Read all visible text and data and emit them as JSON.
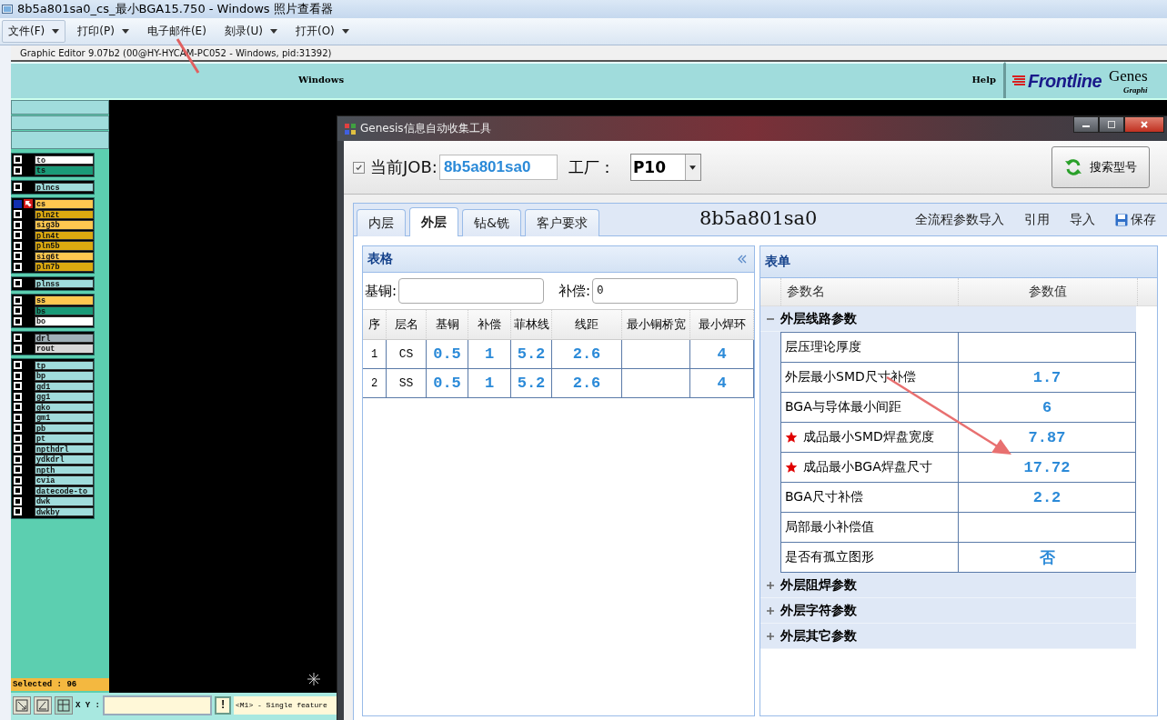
{
  "viewer": {
    "title": "8b5a801sa0_cs_最小BGA15.750 - Windows 照片查看器",
    "menu": [
      {
        "label": "文件(F)",
        "dropdown": true,
        "selected": true
      },
      {
        "label": "打印(P)",
        "dropdown": true,
        "selected": false
      },
      {
        "label": "电子邮件(E)",
        "dropdown": false,
        "selected": false
      },
      {
        "label": "刻录(U)",
        "dropdown": true,
        "selected": false
      },
      {
        "label": "打开(O)",
        "dropdown": true,
        "selected": false
      }
    ]
  },
  "editor": {
    "title": "Graphic Editor 9.07b2 (00@HY-HYCAM-PC052 - Windows, pid:31392)",
    "menus": [
      "Windows",
      "Help"
    ],
    "brand": "Frontline",
    "product": "Genes",
    "product_subtitle": "Graphi",
    "layer_groups": [
      [
        {
          "name": "to",
          "color": "#ffffff",
          "selected": false
        },
        {
          "name": "ts",
          "color": "#1a9a78",
          "selected": false
        }
      ],
      [
        {
          "name": "plncs",
          "color": "#a0dcdc",
          "selected": false
        }
      ],
      [
        {
          "name": "cs",
          "color": "#ffc850",
          "selected": true
        },
        {
          "name": "pln2t",
          "color": "#dcaa10",
          "selected": false
        },
        {
          "name": "sig3b",
          "color": "#ffc850",
          "selected": false
        },
        {
          "name": "pln4t",
          "color": "#dcaa10",
          "selected": false
        },
        {
          "name": "pln5b",
          "color": "#dcaa10",
          "selected": false
        },
        {
          "name": "sig6t",
          "color": "#ffc850",
          "selected": false
        },
        {
          "name": "pln7b",
          "color": "#dcaa10",
          "selected": false
        }
      ],
      [
        {
          "name": "plnss",
          "color": "#a0dcdc",
          "selected": false
        }
      ],
      [
        {
          "name": "ss",
          "color": "#ffc850",
          "selected": false
        },
        {
          "name": "bs",
          "color": "#1a9a78",
          "selected": false
        },
        {
          "name": "bo",
          "color": "#ffffff",
          "selected": false
        }
      ],
      [
        {
          "name": "drl",
          "color": "#a0b0b8",
          "selected": false
        },
        {
          "name": "rout",
          "color": "#d8d8d8",
          "selected": false
        }
      ],
      [
        {
          "name": "tp",
          "color": "#a0dcdc",
          "selected": false
        },
        {
          "name": "bp",
          "color": "#a0dcdc",
          "selected": false
        },
        {
          "name": "gd1",
          "color": "#a0dcdc",
          "selected": false
        },
        {
          "name": "gg1",
          "color": "#a0dcdc",
          "selected": false
        },
        {
          "name": "gko",
          "color": "#a0dcdc",
          "selected": false
        },
        {
          "name": "gm1",
          "color": "#a0dcdc",
          "selected": false
        },
        {
          "name": "pb",
          "color": "#a0dcdc",
          "selected": false
        },
        {
          "name": "pt",
          "color": "#a0dcdc",
          "selected": false
        },
        {
          "name": "npthdrl",
          "color": "#a0dcdc",
          "selected": false
        },
        {
          "name": "ydkdrl",
          "color": "#a0dcdc",
          "selected": false
        },
        {
          "name": "npth",
          "color": "#a0dcdc",
          "selected": false
        },
        {
          "name": "cvia",
          "color": "#a0dcdc",
          "selected": false
        },
        {
          "name": "datecode-to",
          "color": "#a0dcdc",
          "selected": false
        },
        {
          "name": "dwk",
          "color": "#a0dcdc",
          "selected": false
        },
        {
          "name": "dwkby",
          "color": "#a0dcdc",
          "selected": false
        }
      ]
    ],
    "selected_count": "Selected : 96",
    "xy_label": "X Y :",
    "alert_button": "!",
    "status": "<M1> - Single feature"
  },
  "dialog": {
    "title": "Genesis信息自动收集工具",
    "job": {
      "checked": true,
      "label": "当前JOB:",
      "value": "8b5a801sa0"
    },
    "factory": {
      "label": "工厂：",
      "value": "P10"
    },
    "search_button": "搜索型号",
    "tabs": [
      {
        "label": "内层",
        "selected": false
      },
      {
        "label": "外层",
        "selected": true
      },
      {
        "label": "钻&铣",
        "selected": false
      },
      {
        "label": "客户要求",
        "selected": false
      }
    ],
    "job_title": "8b5a801sa0",
    "actions": [
      {
        "label": "全流程参数导入",
        "kind": "link"
      },
      {
        "label": "引用",
        "kind": "link"
      },
      {
        "label": "导入",
        "kind": "link"
      },
      {
        "label": "保存",
        "kind": "save"
      }
    ],
    "table_panel": {
      "title": "表格",
      "fields": [
        {
          "label": "基铜:"
        },
        {
          "label": "补偿:",
          "value": "0"
        }
      ],
      "columns": [
        "序",
        "层名",
        "基铜",
        "补偿",
        "菲林线",
        "线距",
        "最小铜桥宽",
        "最小焊环"
      ],
      "rows": [
        [
          "1",
          "CS",
          "0.5",
          "1",
          "5.2",
          "2.6",
          null,
          "4"
        ],
        [
          "2",
          "SS",
          "0.5",
          "1",
          "5.2",
          "2.6",
          null,
          "4"
        ]
      ]
    },
    "form_panel": {
      "title": "表单",
      "columns": [
        "参数名",
        "参数值"
      ],
      "groups": [
        {
          "label": "外层线路参数",
          "expanded": true,
          "rows": [
            {
              "name": "层压理论厚度",
              "required": false
            },
            {
              "name": "外层最小SMD尺寸补偿",
              "value": "1.7",
              "required": false
            },
            {
              "name": "BGA与导体最小间距",
              "value": "6",
              "required": false
            },
            {
              "name": "成品最小SMD焊盘宽度",
              "value": "7.87",
              "required": true
            },
            {
              "name": "成品最小BGA焊盘尺寸",
              "value": "17.72",
              "required": true
            },
            {
              "name": "BGA尺寸补偿",
              "value": "2.2",
              "required": false
            },
            {
              "name": "局部最小补偿值",
              "required": false
            },
            {
              "name": "是否有孤立图形",
              "value": "否",
              "required": false
            }
          ]
        },
        {
          "label": "外层阻焊参数",
          "expanded": false
        },
        {
          "label": "外层字符参数",
          "expanded": false
        },
        {
          "label": "外层其它参数",
          "expanded": false
        }
      ]
    }
  }
}
